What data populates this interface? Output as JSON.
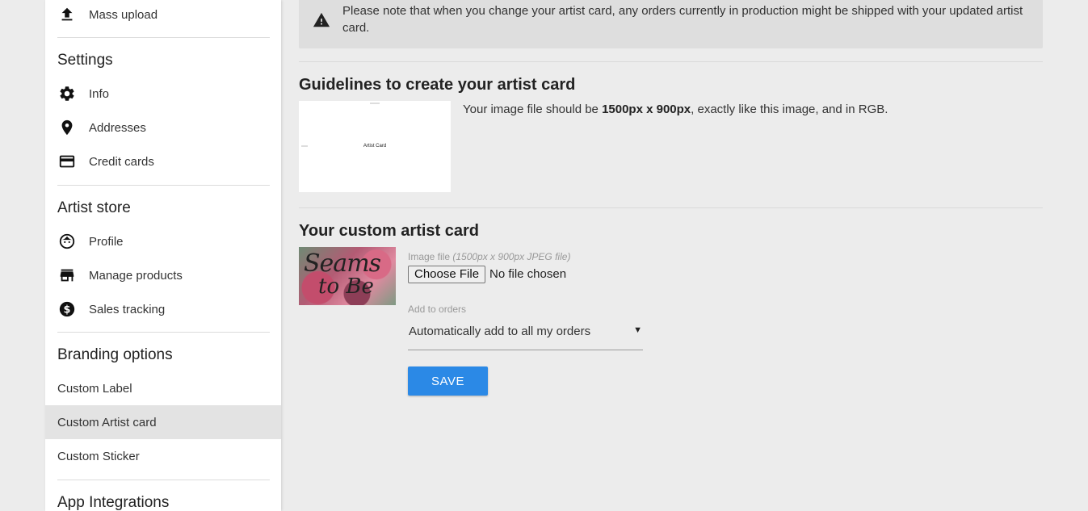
{
  "sidebar": {
    "top_item": {
      "label": "Mass upload",
      "icon": "upload-icon"
    },
    "settings": {
      "title": "Settings",
      "items": [
        {
          "label": "Info",
          "icon": "gear-icon"
        },
        {
          "label": "Addresses",
          "icon": "location-pin-icon"
        },
        {
          "label": "Credit cards",
          "icon": "credit-card-icon"
        }
      ]
    },
    "artist_store": {
      "title": "Artist store",
      "items": [
        {
          "label": "Profile",
          "icon": "face-icon"
        },
        {
          "label": "Manage products",
          "icon": "store-icon"
        },
        {
          "label": "Sales tracking",
          "icon": "dollar-circle-icon"
        }
      ]
    },
    "branding": {
      "title": "Branding options",
      "items": [
        {
          "label": "Custom Label",
          "selected": false
        },
        {
          "label": "Custom Artist card",
          "selected": true
        },
        {
          "label": "Custom Sticker",
          "selected": false
        }
      ]
    },
    "integrations": {
      "title": "App Integrations"
    }
  },
  "notice": {
    "icon": "warning-triangle-icon",
    "text": "Please note that when you change your artist card, any orders currently in production might be shipped with your updated artist card."
  },
  "guidelines": {
    "title": "Guidelines to create your artist card",
    "image_label": "Artist Card",
    "text_before": "Your image file should be ",
    "text_bold": "1500px x 900px",
    "text_after": ", exactly like this image, and in RGB."
  },
  "custom_card": {
    "title": "Your custom artist card",
    "thumb_text_1": "Seams",
    "thumb_text_2": "to Be",
    "file_label": "Image file ",
    "file_hint": "(1500px x 900px JPEG file)",
    "choose_file": "Choose File",
    "file_status": "No file chosen",
    "orders_label": "Add to orders",
    "orders_value": "Automatically add to all my orders",
    "save_label": "SAVE"
  },
  "colors": {
    "accent": "#2b89e6",
    "selected_bg": "#e3e3e3",
    "notice_bg": "#dedede"
  }
}
